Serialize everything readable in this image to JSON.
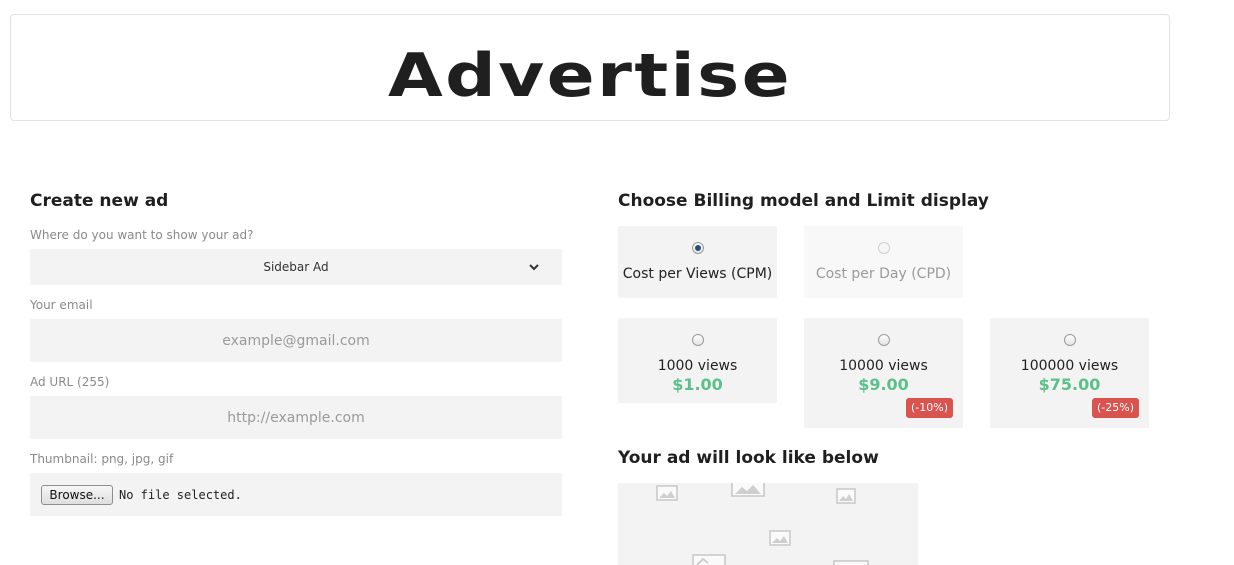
{
  "header": {
    "title": "Advertise"
  },
  "create_ad": {
    "heading": "Create new ad",
    "placement": {
      "label": "Where do you want to show your ad?",
      "selected": "Sidebar Ad"
    },
    "email": {
      "label": "Your email",
      "placeholder": "example@gmail.com"
    },
    "url": {
      "label": "Ad URL (255)",
      "placeholder": "http://example.com"
    },
    "thumbnail": {
      "label": "Thumbnail: png, jpg, gif",
      "browse_label": "Browse...",
      "status": "No file selected."
    }
  },
  "billing": {
    "heading": "Choose Billing model and Limit display",
    "models": [
      {
        "label": "Cost per Views (CPM)",
        "selected": true,
        "enabled": true
      },
      {
        "label": "Cost per Day (CPD)",
        "selected": false,
        "enabled": false
      }
    ],
    "packages": [
      {
        "views": "1000 views",
        "price": "$1.00",
        "discount": ""
      },
      {
        "views": "10000 views",
        "price": "$9.00",
        "discount": "(-10%)"
      },
      {
        "views": "100000 views",
        "price": "$75.00",
        "discount": "(-25%)"
      }
    ]
  },
  "preview": {
    "heading": "Your ad will look like below"
  },
  "colors": {
    "price_green": "#5cc08a",
    "badge_red": "#d9534f",
    "field_bg": "#f3f3f3"
  }
}
